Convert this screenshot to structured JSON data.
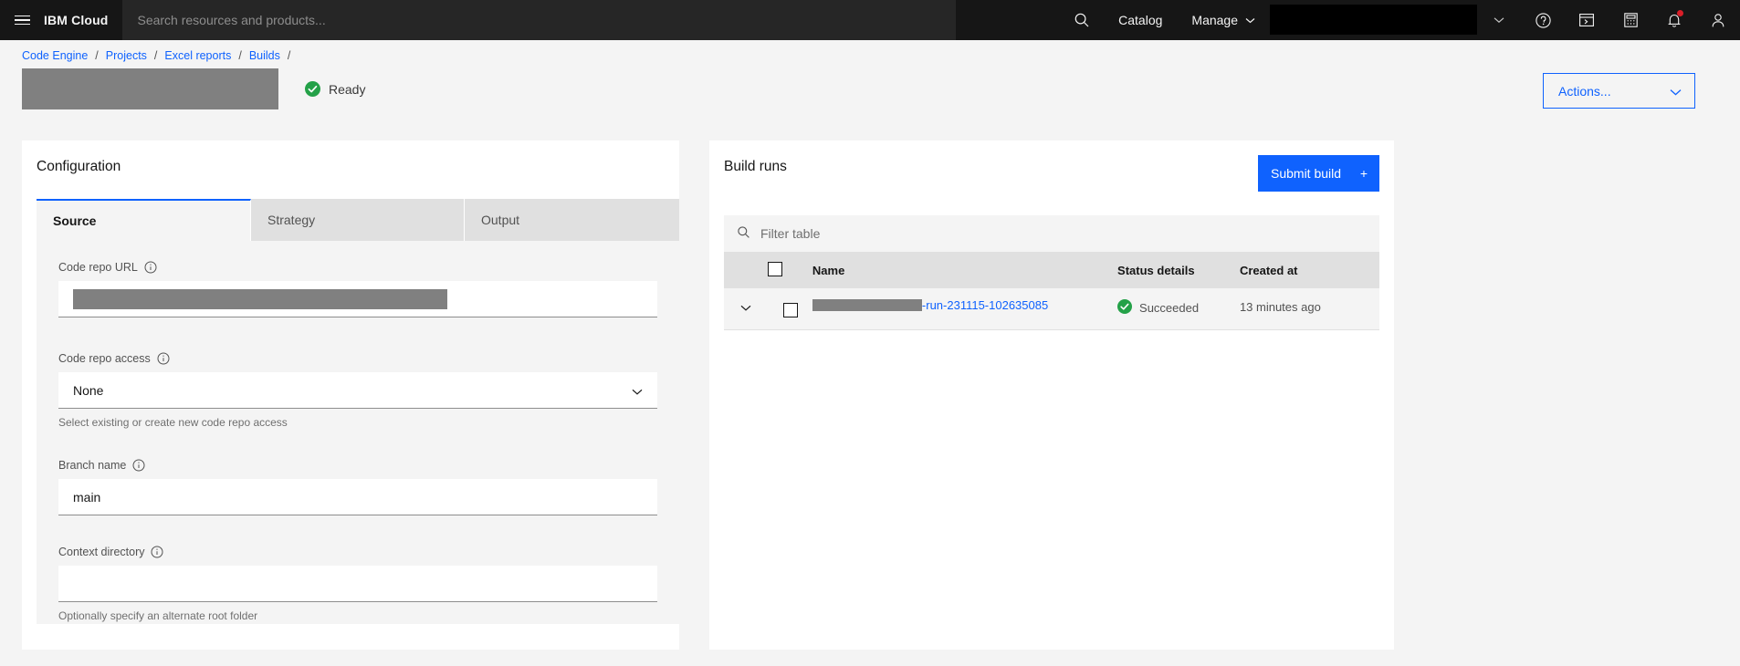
{
  "header": {
    "menu_icon": "hamburger-menu-icon",
    "brand_ibm": "IBM",
    "brand_cloud": "Cloud",
    "search_placeholder": "Search resources and products...",
    "search_icon": "search-icon",
    "catalog_label": "Catalog",
    "manage_label": "Manage",
    "manage_chevron": "chevron-down-icon",
    "account_chevron": "chevron-down-icon",
    "help_icon": "help-icon",
    "shell_icon": "terminal-icon",
    "cost_icon": "calculator-icon",
    "notifications_icon": "bell-icon",
    "profile_icon": "user-avatar-icon",
    "notification_dot_color": "#da1e28"
  },
  "breadcrumb": {
    "items": [
      {
        "label": "Code Engine"
      },
      {
        "label": "Projects"
      },
      {
        "label": "Excel reports"
      },
      {
        "label": "Builds"
      }
    ],
    "separator": "/"
  },
  "page": {
    "status_label": "Ready",
    "status_icon": "check-circle-filled-icon",
    "status_color": "#24a148",
    "actions_label": "Actions...",
    "actions_chevron": "chevron-down-icon",
    "accent_color": "#0f62fe"
  },
  "configuration": {
    "title": "Configuration",
    "tabs": [
      {
        "label": "Source",
        "active": true
      },
      {
        "label": "Strategy",
        "active": false
      },
      {
        "label": "Output",
        "active": false
      }
    ],
    "fields": {
      "code_repo_url": {
        "label": "Code repo URL",
        "info_icon": "information-icon",
        "value": ""
      },
      "code_repo_access": {
        "label": "Code repo access",
        "info_icon": "information-icon",
        "value": "None",
        "chevron": "chevron-down-icon",
        "helper": "Select existing or create new code repo access"
      },
      "branch_name": {
        "label": "Branch name",
        "info_icon": "information-icon",
        "value": "main"
      },
      "context_directory": {
        "label": "Context directory",
        "info_icon": "information-icon",
        "value": "",
        "helper": "Optionally specify an alternate root folder"
      }
    }
  },
  "build_runs": {
    "title": "Build runs",
    "submit_label": "Submit build",
    "submit_plus": "+",
    "filter_placeholder": "Filter table",
    "filter_icon": "search-icon",
    "columns": [
      {
        "label": "Name"
      },
      {
        "label": "Status details"
      },
      {
        "label": "Created at"
      }
    ],
    "rows": [
      {
        "expand_icon": "chevron-down-icon",
        "name_suffix": "-run-231115-102635085",
        "status": "Succeeded",
        "status_icon": "check-circle-filled-icon",
        "created_at": "13 minutes ago"
      }
    ]
  }
}
